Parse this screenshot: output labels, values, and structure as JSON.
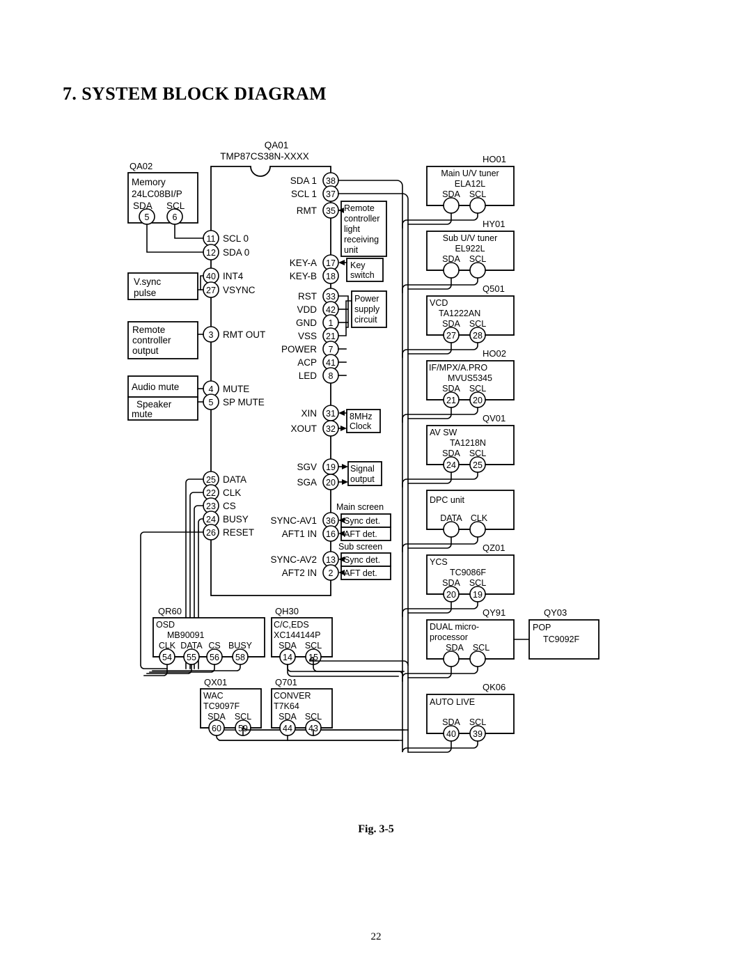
{
  "document": {
    "section_title": "7.  SYSTEM BLOCK DIAGRAM",
    "figure_caption": "Fig. 3-5",
    "page_number": "22"
  },
  "main_ic": {
    "ref": "QA01",
    "part": "TMP87CS38N-XXXX",
    "pins_right": [
      {
        "label": "SDA 1",
        "pin": "38"
      },
      {
        "label": "SCL 1",
        "pin": "37"
      },
      {
        "label": "RMT",
        "pin": "35"
      },
      {
        "label": "KEY-A",
        "pin": "17"
      },
      {
        "label": "KEY-B",
        "pin": "18"
      },
      {
        "label": "RST",
        "pin": "33"
      },
      {
        "label": "VDD",
        "pin": "42"
      },
      {
        "label": "GND",
        "pin": "1"
      },
      {
        "label": "VSS",
        "pin": "21"
      },
      {
        "label": "POWER",
        "pin": "7"
      },
      {
        "label": "ACP",
        "pin": "41"
      },
      {
        "label": "LED",
        "pin": "8"
      },
      {
        "label": "XIN",
        "pin": "31"
      },
      {
        "label": "XOUT",
        "pin": "32"
      },
      {
        "label": "SGV",
        "pin": "19"
      },
      {
        "label": "SGA",
        "pin": "20"
      },
      {
        "label": "SYNC-AV1",
        "pin": "36"
      },
      {
        "label": "AFT1 IN",
        "pin": "16"
      },
      {
        "label": "SYNC-AV2",
        "pin": "13"
      },
      {
        "label": "AFT2 IN",
        "pin": "2"
      }
    ],
    "pins_left": [
      {
        "label": "SCL 0",
        "pin": "11"
      },
      {
        "label": "SDA 0",
        "pin": "12"
      },
      {
        "label": "INT4",
        "pin": "40"
      },
      {
        "label": "VSYNC",
        "pin": "27"
      },
      {
        "label": "RMT OUT",
        "pin": "3"
      },
      {
        "label": "MUTE",
        "pin": "4"
      },
      {
        "label": "SP MUTE",
        "pin": "5"
      },
      {
        "label": "DATA",
        "pin": "25"
      },
      {
        "label": "CLK",
        "pin": "22"
      },
      {
        "label": "CS",
        "pin": "23"
      },
      {
        "label": "BUSY",
        "pin": "24"
      },
      {
        "label": "RESET",
        "pin": "26"
      }
    ]
  },
  "left_blocks": [
    {
      "ref": "QA02",
      "lines": [
        "Memory",
        "24LC08BI/P"
      ],
      "pin_labels": [
        "SDA",
        "SCL"
      ],
      "pins": [
        "5",
        "6"
      ]
    },
    {
      "ref": "",
      "lines": [
        "V.sync",
        "pulse"
      ],
      "pin_labels": [],
      "pins": []
    },
    {
      "ref": "",
      "lines": [
        "Remote",
        "controller",
        "output"
      ],
      "pin_labels": [],
      "pins": []
    },
    {
      "ref": "",
      "lines": [
        "Audio  mute"
      ],
      "pin_labels": [],
      "pins": []
    },
    {
      "ref": "",
      "lines": [
        "Speaker",
        "mute"
      ],
      "pin_labels": [],
      "pins": []
    }
  ],
  "center_blocks": [
    {
      "lines": [
        "Remote",
        "controller",
        "light",
        "receiving",
        "unit"
      ]
    },
    {
      "lines": [
        "Key",
        "switch"
      ]
    },
    {
      "lines": [
        "Power",
        "supply",
        "circuit"
      ]
    },
    {
      "lines": [
        "8MHz",
        "Clock"
      ]
    },
    {
      "lines": [
        "Signal",
        "output"
      ]
    },
    {
      "lines": [
        "Sync  det."
      ]
    },
    {
      "lines": [
        "AFT  det."
      ]
    },
    {
      "lines": [
        "Sync  det."
      ]
    },
    {
      "lines": [
        "AFT  det."
      ]
    }
  ],
  "screen_labels": {
    "main": "Main screen",
    "sub": "Sub screen"
  },
  "right_blocks": [
    {
      "ref": "HO01",
      "lines": [
        "Main  U/V tuner",
        "ELA12L"
      ],
      "pin_labels": [
        "SDA",
        "SCL"
      ],
      "pins": [
        "",
        ""
      ]
    },
    {
      "ref": "HY01",
      "lines": [
        "Sub  U/V tuner",
        "EL922L"
      ],
      "pin_labels": [
        "SDA",
        "SCL"
      ],
      "pins": [
        "",
        ""
      ]
    },
    {
      "ref": "Q501",
      "lines": [
        "VCD",
        "TA1222AN"
      ],
      "pin_labels": [
        "SDA",
        "SCL"
      ],
      "pins": [
        "27",
        "28"
      ]
    },
    {
      "ref": "HO02",
      "lines": [
        "IF/MPX/A.PRO",
        "MVUS5345"
      ],
      "pin_labels": [
        "SDA",
        "SCL"
      ],
      "pins": [
        "21",
        "20"
      ]
    },
    {
      "ref": "QV01",
      "lines": [
        "AV  SW",
        "TA1218N"
      ],
      "pin_labels": [
        "SDA",
        "SCL"
      ],
      "pins": [
        "24",
        "25"
      ]
    },
    {
      "ref": "",
      "lines": [
        "DPC  unit",
        ""
      ],
      "pin_labels": [
        "DATA",
        "CLK"
      ],
      "pins": [
        "",
        ""
      ]
    },
    {
      "ref": "QZ01",
      "lines": [
        "YCS",
        "TC9086F"
      ],
      "pin_labels": [
        "SDA",
        "SCL"
      ],
      "pins": [
        "20",
        "19"
      ]
    },
    {
      "ref": "QY91",
      "lines": [
        "DUAL  micro-",
        "processor"
      ],
      "pin_labels": [
        "SDA",
        "SCL"
      ],
      "pins": [
        "",
        ""
      ]
    },
    {
      "ref": "QK06",
      "lines": [
        "AUTO  LIVE",
        ""
      ],
      "pin_labels": [
        "SDA",
        "SCL"
      ],
      "pins": [
        "40",
        "39"
      ]
    }
  ],
  "pop_block": {
    "ref": "QY03",
    "lines": [
      "POP",
      "TC9092F"
    ]
  },
  "bottom_blocks": [
    {
      "ref": "QR60",
      "lines": [
        "OSD",
        "MB90091"
      ],
      "pin_labels": [
        "CLK",
        "DATA",
        "CS",
        "BUSY"
      ],
      "pins": [
        "54",
        "55",
        "56",
        "58"
      ]
    },
    {
      "ref": "QH30",
      "lines": [
        "C/C,EDS",
        "XC144144P"
      ],
      "pin_labels": [
        "SDA",
        "SCL"
      ],
      "pins": [
        "14",
        "15"
      ]
    },
    {
      "ref": "QX01",
      "lines": [
        "WAC",
        "TC9097F"
      ],
      "pin_labels": [
        "SDA",
        "SCL"
      ],
      "pins": [
        "60",
        "59"
      ]
    },
    {
      "ref": "Q701",
      "lines": [
        "CONVER",
        "T7K64"
      ],
      "pin_labels": [
        "SDA",
        "SCL"
      ],
      "pins": [
        "44",
        "43"
      ]
    }
  ]
}
